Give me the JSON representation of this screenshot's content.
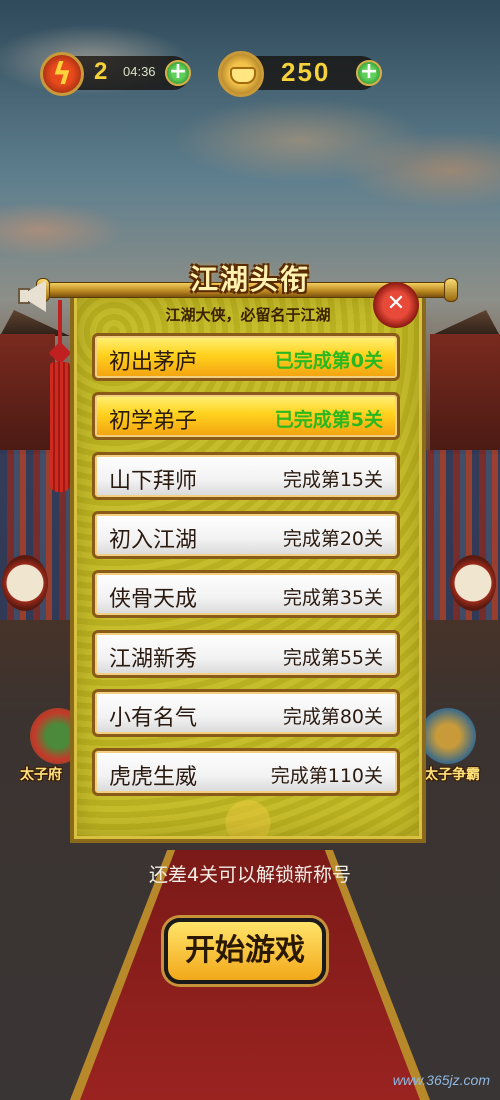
{
  "hud": {
    "energy": "2",
    "energy_timer": "04:36",
    "gold": "250",
    "plus_symbol": "+"
  },
  "side": {
    "left_label": "太子府",
    "right_label": "太子争霸"
  },
  "panel": {
    "title": "江湖头衔",
    "subtitle": "江湖大侠，必留名于江湖",
    "close_symbol": "✕"
  },
  "titles": [
    {
      "name": "初出茅庐",
      "requirement": "已完成第0关",
      "status": "done"
    },
    {
      "name": "初学弟子",
      "requirement": "已完成第5关",
      "status": "done"
    },
    {
      "name": "山下拜师",
      "requirement": "完成第15关",
      "status": "locked"
    },
    {
      "name": "初入江湖",
      "requirement": "完成第20关",
      "status": "locked"
    },
    {
      "name": "侠骨天成",
      "requirement": "完成第35关",
      "status": "locked"
    },
    {
      "name": "江湖新秀",
      "requirement": "完成第55关",
      "status": "locked"
    },
    {
      "name": "小有名气",
      "requirement": "完成第80关",
      "status": "locked"
    },
    {
      "name": "虎虎生威",
      "requirement": "完成第110关",
      "status": "locked"
    }
  ],
  "remaining_text": "还差4关可以解锁新称号",
  "start_button": "开始游戏",
  "watermark": "www.365jz.com",
  "colors": {
    "done_requirement": "#2ab820",
    "done_row": "#ffd21e",
    "locked_row": "#f2f2f2",
    "panel": "#c0b828"
  }
}
